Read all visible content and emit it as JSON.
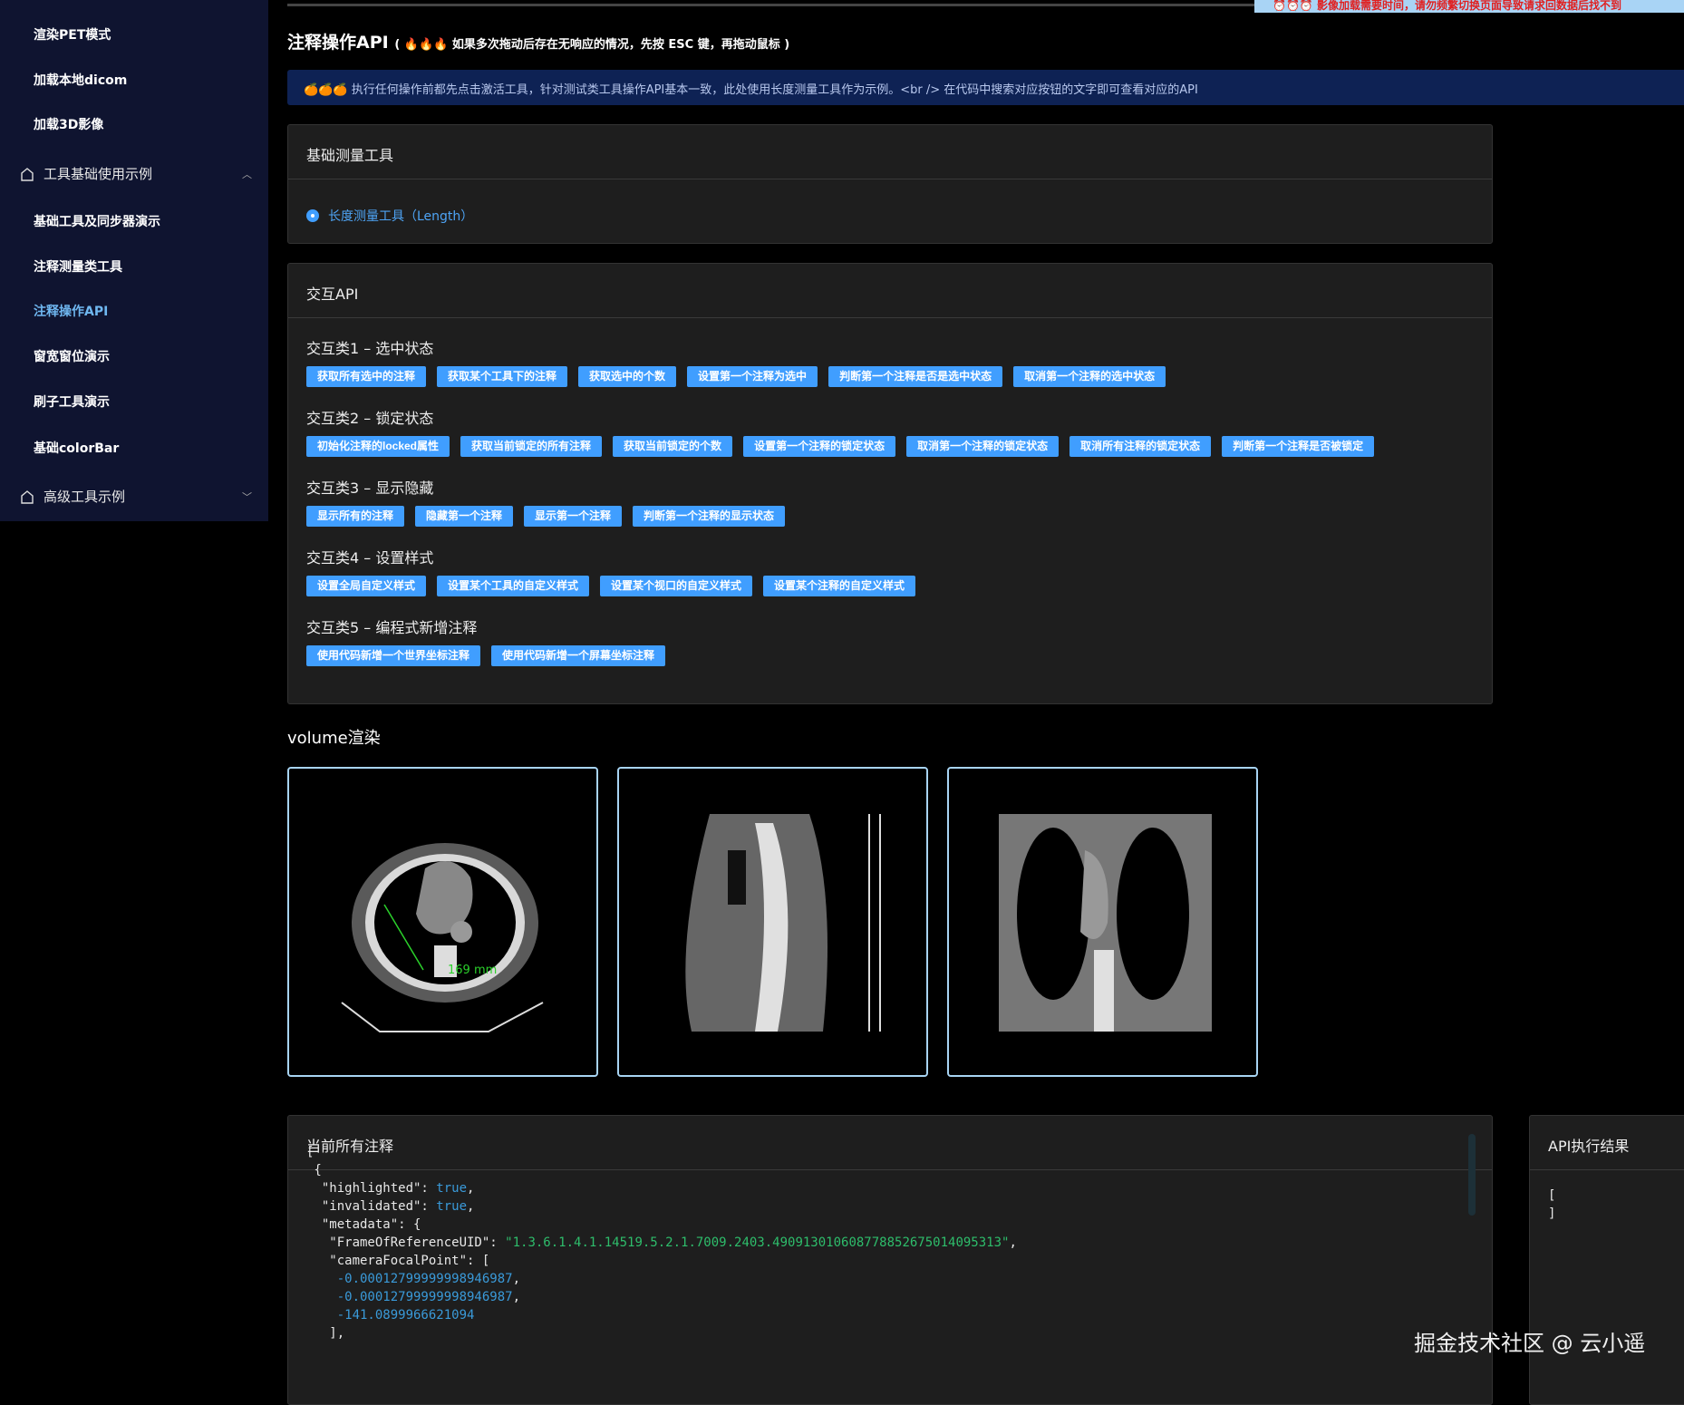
{
  "sidebar": {
    "items": [
      {
        "label": "渲染PET模式"
      },
      {
        "label": "加载本地dicom"
      },
      {
        "label": "加载3D影像"
      },
      {
        "label": "工具基础使用示例",
        "group": true,
        "expanded": true
      },
      {
        "label": "基础工具及同步器演示"
      },
      {
        "label": "注释测量类工具"
      },
      {
        "label": "注释操作API",
        "active": true
      },
      {
        "label": "窗宽窗位演示"
      },
      {
        "label": "刷子工具演示"
      },
      {
        "label": "基础colorBar"
      },
      {
        "label": "高级工具示例",
        "group": true,
        "expanded": false
      }
    ]
  },
  "banner": "⏰⏰⏰ 影像加载需要时间，请勿频繁切换页面导致请求回数据后找不到",
  "title": {
    "main": "注释操作API",
    "note": "( 🔥🔥🔥 如果多次拖动后存在无响应的情况，先按 ESC 键，再拖动鼠标 )"
  },
  "info": "🍊🍊🍊 执行任何操作前都先点击激活工具，针对测试类工具操作API基本一致，此处使用长度测量工具作为示例。<br /> 在代码中搜索对应按钮的文字即可查看对应的API",
  "basic_panel": {
    "title": "基础测量工具",
    "tool": "长度测量工具（Length）"
  },
  "api_panel": {
    "title": "交互API",
    "sections": [
      {
        "title": "交互类1 – 选中状态",
        "buttons": [
          "获取所有选中的注释",
          "获取某个工具下的注释",
          "获取选中的个数",
          "设置第一个注释为选中",
          "判断第一个注释是否是选中状态",
          "取消第一个注释的选中状态"
        ]
      },
      {
        "title": "交互类2 – 锁定状态",
        "buttons": [
          "初始化注释的locked属性",
          "获取当前锁定的所有注释",
          "获取当前锁定的个数",
          "设置第一个注释的锁定状态",
          "取消第一个注释的锁定状态",
          "取消所有注释的锁定状态",
          "判断第一个注释是否被锁定"
        ]
      },
      {
        "title": "交互类3 – 显示隐藏",
        "buttons": [
          "显示所有的注释",
          "隐藏第一个注释",
          "显示第一个注释",
          "判断第一个注释的显示状态"
        ]
      },
      {
        "title": "交互类4 – 设置样式",
        "buttons": [
          "设置全局自定义样式",
          "设置某个工具的自定义样式",
          "设置某个视口的自定义样式",
          "设置某个注释的自定义样式"
        ]
      },
      {
        "title": "交互类5 – 编程式新增注释",
        "buttons": [
          "使用代码新增一个世界坐标注释",
          "使用代码新增一个屏幕坐标注释"
        ]
      }
    ]
  },
  "volume": {
    "title": "volume渲染",
    "measurement": "169 mm"
  },
  "annotations_panel": {
    "title": "当前所有注释",
    "lines": [
      [
        "[",
        ""
      ],
      [
        " {",
        ""
      ],
      [
        "  \"highlighted\": ",
        "true",
        ","
      ],
      [
        "  \"invalidated\": ",
        "true",
        ","
      ],
      [
        "  \"metadata\": {",
        ""
      ],
      [
        "   \"FrameOfReferenceUID\": ",
        "\"1.3.6.1.4.1.14519.5.2.1.7009.2403.490913010608778852675014095313\"",
        ","
      ],
      [
        "   \"cameraFocalPoint\": [",
        ""
      ],
      [
        "    ",
        "-0.00012799999998946987",
        ","
      ],
      [
        "    ",
        "-0.00012799999998946987",
        ","
      ],
      [
        "    ",
        "-141.0899966621094",
        ""
      ],
      [
        "   ],",
        ""
      ]
    ]
  },
  "result_panel": {
    "title": "API执行结果",
    "lines": [
      "[",
      "]"
    ]
  },
  "watermark": "掘金技术社区 @ 云小遥"
}
